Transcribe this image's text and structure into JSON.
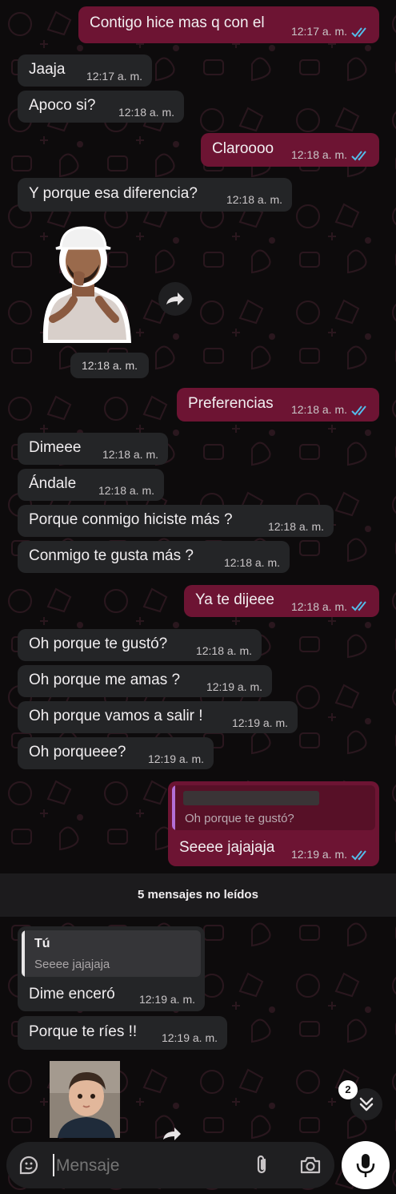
{
  "messages": [
    {
      "text": "Contigo hice mas q con el",
      "time": "12:17 a. m."
    },
    {
      "text": "Jaaja",
      "time": "12:17 a. m."
    },
    {
      "text": "Apoco si?",
      "time": "12:18 a. m."
    },
    {
      "text": "Claroooo",
      "time": "12:18 a. m."
    },
    {
      "text": "Y porque esa diferencia?",
      "time": "12:18 a. m."
    },
    {
      "text": "Preferencias",
      "time": "12:18 a. m."
    },
    {
      "text": "Dimeee",
      "time": "12:18 a. m."
    },
    {
      "text": "Ándale",
      "time": "12:18 a. m."
    },
    {
      "text": "Porque conmigo hiciste más ?",
      "time": "12:18 a. m."
    },
    {
      "text": "Conmigo te gusta más ?",
      "time": "12:18 a. m."
    },
    {
      "text": "Ya te dijeee",
      "time": "12:18 a. m."
    },
    {
      "text": "Oh porque te gustó?",
      "time": "12:18 a. m."
    },
    {
      "text": "Oh porque me amas ?",
      "time": "12:19 a. m."
    },
    {
      "text": "Oh porque vamos a salir !",
      "time": "12:19 a. m."
    },
    {
      "text": "Oh porqueee?",
      "time": "12:19 a. m."
    },
    {
      "text": "Seeee jajajaja",
      "time": "12:19 a. m."
    },
    {
      "text": "Dime enceró",
      "time": "12:19 a. m."
    },
    {
      "text": "Porque te ríes !!",
      "time": "12:19 a. m."
    }
  ],
  "sticker": {
    "time": "12:18 a. m."
  },
  "reply_out": {
    "quoted_text": "Oh porque te gustó?"
  },
  "reply_in": {
    "author": "Tú",
    "quoted_text": "Seeee jajajaja"
  },
  "unread_banner": "5 mensajes no leídos",
  "scroll_badge": "2",
  "composer": {
    "placeholder": "Mensaje"
  },
  "colors": {
    "outgoing": "#6d1433",
    "incoming": "#242527",
    "read_ticks": "#53bdeb"
  },
  "icons": [
    "sticker-icon",
    "attach-icon",
    "camera-icon",
    "mic-icon",
    "forward-icon",
    "chevrons-down-icon",
    "double-check-icon"
  ]
}
